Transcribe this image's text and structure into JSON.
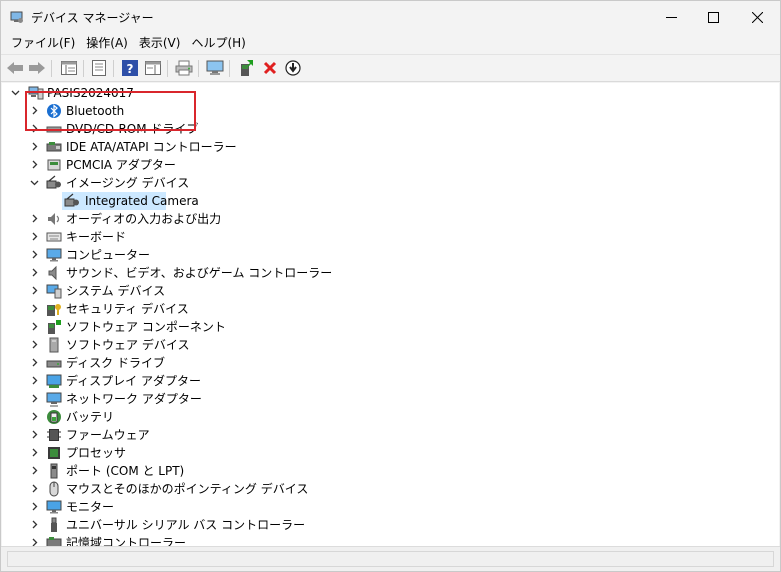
{
  "window": {
    "title": "デバイス マネージャー"
  },
  "menu": [
    "ファイル(F)",
    "操作(A)",
    "表示(V)",
    "ヘルプ(H)"
  ],
  "tree": {
    "root": "PASIS2024017",
    "items": [
      {
        "label": "Bluetooth",
        "icon": "bluetooth-icon",
        "expanded": false
      },
      {
        "label": "DVD/CD-ROM ドライブ",
        "icon": "dvd-drive-icon",
        "expanded": false
      },
      {
        "label": "IDE ATA/ATAPI コントローラー",
        "icon": "ide-controller-icon",
        "expanded": false
      },
      {
        "label": "PCMCIA アダプター",
        "icon": "pcmcia-icon",
        "expanded": false
      },
      {
        "label": "イメージング デバイス",
        "icon": "camera-icon",
        "expanded": true,
        "children": [
          "Integrated Camera"
        ]
      },
      {
        "label": "オーディオの入力および出力",
        "icon": "audio-io-icon",
        "expanded": false
      },
      {
        "label": "キーボード",
        "icon": "keyboard-icon",
        "expanded": false
      },
      {
        "label": "コンピューター",
        "icon": "computer-icon",
        "expanded": false
      },
      {
        "label": "サウンド、ビデオ、およびゲーム コントローラー",
        "icon": "speaker-icon",
        "expanded": false
      },
      {
        "label": "システム デバイス",
        "icon": "system-device-icon",
        "expanded": false
      },
      {
        "label": "セキュリティ デバイス",
        "icon": "security-device-icon",
        "expanded": false
      },
      {
        "label": "ソフトウェア コンポーネント",
        "icon": "software-component-icon",
        "expanded": false
      },
      {
        "label": "ソフトウェア デバイス",
        "icon": "software-device-icon",
        "expanded": false
      },
      {
        "label": "ディスク ドライブ",
        "icon": "disk-drive-icon",
        "expanded": false
      },
      {
        "label": "ディスプレイ アダプター",
        "icon": "display-adapter-icon",
        "expanded": false
      },
      {
        "label": "ネットワーク アダプター",
        "icon": "network-adapter-icon",
        "expanded": false
      },
      {
        "label": "バッテリ",
        "icon": "battery-icon",
        "expanded": false
      },
      {
        "label": "ファームウェア",
        "icon": "firmware-icon",
        "expanded": false
      },
      {
        "label": "プロセッサ",
        "icon": "processor-icon",
        "expanded": false
      },
      {
        "label": "ポート (COM と LPT)",
        "icon": "port-icon",
        "expanded": false
      },
      {
        "label": "マウスとそのほかのポインティング デバイス",
        "icon": "mouse-icon",
        "expanded": false
      },
      {
        "label": "モニター",
        "icon": "monitor-icon",
        "expanded": false
      },
      {
        "label": "ユニバーサル シリアル バス コントローラー",
        "icon": "usb-icon",
        "expanded": false
      },
      {
        "label": "記憶域コントローラー",
        "icon": "storage-controller-icon",
        "expanded": false
      }
    ]
  },
  "colors": {
    "selection": "#cce8ff",
    "highlight_border": "#d9262c",
    "uninstall_x": "#e02020"
  }
}
